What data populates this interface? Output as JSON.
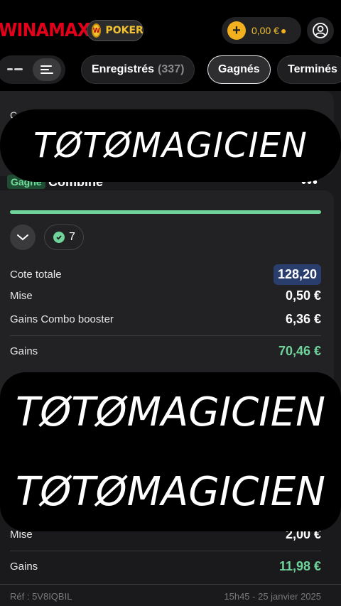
{
  "header": {
    "logo": "WINAMAX",
    "poker_label": "POKER",
    "balance": "0,00 €"
  },
  "tabs": [
    {
      "label": "Enregistrés",
      "count": "(337)"
    },
    {
      "label": "Gagnés"
    },
    {
      "label": "Terminés"
    }
  ],
  "bet1": {
    "status_badge": "Gagné",
    "type_label": "Combiné"
  },
  "bet2": {
    "selections_won": "7",
    "rows": {
      "cote_totale_label": "Cote totale",
      "cote_totale_value": "128,20",
      "mise_label": "Mise",
      "mise_value": "0,50 €",
      "booster_label": "Gains Combo booster",
      "booster_value": "6,36 €",
      "gains_label": "Gains",
      "gains_value": "70,46 €"
    }
  },
  "bet3": {
    "mise_label": "Mise",
    "mise_value": "2,00 €",
    "gains_label": "Gains",
    "gains_value": "11,98 €",
    "reference": "Réf : 5V8IQBIL",
    "datetime": "15h45 - 25 janvier 2025"
  },
  "watermark": {
    "text": "TØTØMAGICIEN"
  },
  "colors": {
    "brand_red": "#e2001a",
    "win_green": "#6fd39a",
    "odds_blue": "#2a3e6e",
    "gold": "#f2c230"
  }
}
